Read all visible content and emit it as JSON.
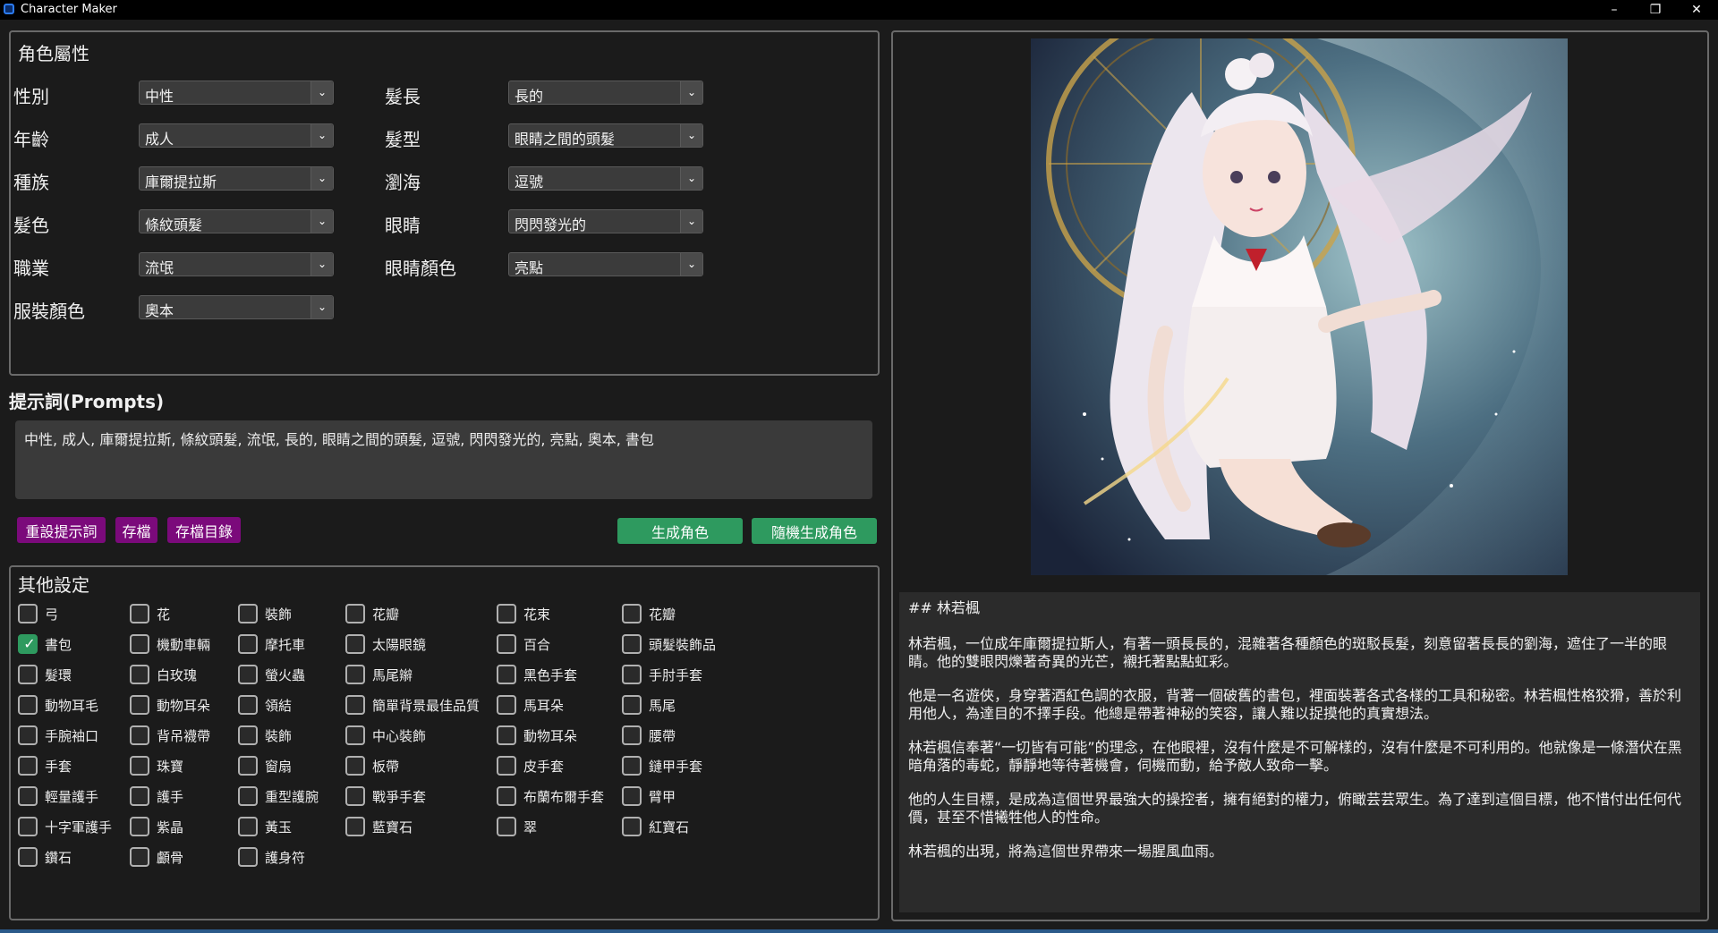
{
  "window": {
    "title": "Character Maker"
  },
  "attributes": {
    "title": "角色屬性",
    "left": [
      {
        "label": "性別",
        "value": "中性"
      },
      {
        "label": "年齡",
        "value": "成人"
      },
      {
        "label": "種族",
        "value": "庫爾提拉斯"
      },
      {
        "label": "髮色",
        "value": "條紋頭髮"
      },
      {
        "label": "職業",
        "value": "流氓"
      },
      {
        "label": "服裝顏色",
        "value": "奧本"
      }
    ],
    "right": [
      {
        "label": "髮長",
        "value": "長的"
      },
      {
        "label": "髮型",
        "value": "眼睛之間的頭髮"
      },
      {
        "label": "瀏海",
        "value": "逗號"
      },
      {
        "label": "眼睛",
        "value": "閃閃發光的"
      },
      {
        "label": "眼睛顏色",
        "value": "亮點"
      }
    ]
  },
  "prompts": {
    "title": "提示詞(Prompts)",
    "text": "中性, 成人, 庫爾提拉斯, 條紋頭髮, 流氓, 長的, 眼睛之間的頭髮, 逗號, 閃閃發光的, 亮點, 奧本, 書包",
    "buttons": {
      "reset": "重設提示詞",
      "save": "存檔",
      "save_dir": "存檔目錄",
      "generate": "生成角色",
      "random_generate": "隨機生成角色"
    }
  },
  "other_settings": {
    "title": "其他設定",
    "items": [
      {
        "label": "弓",
        "checked": false
      },
      {
        "label": "花",
        "checked": false
      },
      {
        "label": "裝飾",
        "checked": false
      },
      {
        "label": "花瓣",
        "checked": false
      },
      {
        "label": "花束",
        "checked": false
      },
      {
        "label": "花瓣",
        "checked": false
      },
      {
        "label": "書包",
        "checked": true
      },
      {
        "label": "機動車輛",
        "checked": false
      },
      {
        "label": "摩托車",
        "checked": false
      },
      {
        "label": "太陽眼鏡",
        "checked": false
      },
      {
        "label": "百合",
        "checked": false
      },
      {
        "label": "頭髮裝飾品",
        "checked": false
      },
      {
        "label": "髮環",
        "checked": false
      },
      {
        "label": "白玫瑰",
        "checked": false
      },
      {
        "label": "螢火蟲",
        "checked": false
      },
      {
        "label": "馬尾辮",
        "checked": false
      },
      {
        "label": "黑色手套",
        "checked": false
      },
      {
        "label": "手肘手套",
        "checked": false
      },
      {
        "label": "動物耳毛",
        "checked": false
      },
      {
        "label": "動物耳朵",
        "checked": false
      },
      {
        "label": "領結",
        "checked": false
      },
      {
        "label": "簡單背景最佳品質",
        "checked": false
      },
      {
        "label": "馬耳朵",
        "checked": false
      },
      {
        "label": "馬尾",
        "checked": false
      },
      {
        "label": "手腕袖口",
        "checked": false
      },
      {
        "label": "背吊襪帶",
        "checked": false
      },
      {
        "label": "裝飾",
        "checked": false
      },
      {
        "label": "中心裝飾",
        "checked": false
      },
      {
        "label": "動物耳朵",
        "checked": false
      },
      {
        "label": "腰帶",
        "checked": false
      },
      {
        "label": "手套",
        "checked": false
      },
      {
        "label": "珠寶",
        "checked": false
      },
      {
        "label": "窗扇",
        "checked": false
      },
      {
        "label": "板帶",
        "checked": false
      },
      {
        "label": "皮手套",
        "checked": false
      },
      {
        "label": "鏈甲手套",
        "checked": false
      },
      {
        "label": "輕量護手",
        "checked": false
      },
      {
        "label": "護手",
        "checked": false
      },
      {
        "label": "重型護腕",
        "checked": false
      },
      {
        "label": "戰爭手套",
        "checked": false
      },
      {
        "label": "布蘭布爾手套",
        "checked": false
      },
      {
        "label": "臂甲",
        "checked": false
      },
      {
        "label": "十字軍護手",
        "checked": false
      },
      {
        "label": "紫晶",
        "checked": false
      },
      {
        "label": "黃玉",
        "checked": false
      },
      {
        "label": "藍寶石",
        "checked": false
      },
      {
        "label": "翠",
        "checked": false
      },
      {
        "label": "紅寶石",
        "checked": false
      },
      {
        "label": "鑽石",
        "checked": false
      },
      {
        "label": "顱骨",
        "checked": false
      },
      {
        "label": "護身符",
        "checked": false
      }
    ]
  },
  "character": {
    "heading": "## 林若楓",
    "paragraphs": [
      "林若楓，一位成年庫爾提拉斯人，有著一頭長長的，混雜著各種顏色的斑駁長髮，刻意留著長長的劉海，遮住了一半的眼睛。他的雙眼閃爍著奇異的光芒，襯托著點點虹彩。",
      "他是一名遊俠，身穿著酒紅色調的衣服，背著一個破舊的書包，裡面裝著各式各樣的工具和秘密。林若楓性格狡猾，善於利用他人，為達目的不擇手段。他總是帶著神秘的笑容，讓人難以捉摸他的真實想法。",
      "林若楓信奉著“一切皆有可能”的理念，在他眼裡，沒有什麼是不可解樣的，沒有什麼是不可利用的。他就像是一條潛伏在黑暗角落的毒蛇，靜靜地等待著機會，伺機而動，給予敵人致命一擊。",
      "他的人生目標，是成為這個世界最強大的操控者，擁有絕對的權力，俯瞰芸芸眾生。為了達到這個目標，他不惜付出任何代價，甚至不惜犧牲他人的性命。",
      "林若楓的出現，將為這個世界帶來一場腥風血雨。"
    ]
  },
  "colors": {
    "accent_purple": "#7b0a7b",
    "accent_green": "#2e9a5f",
    "background": "#1b1b1b"
  }
}
